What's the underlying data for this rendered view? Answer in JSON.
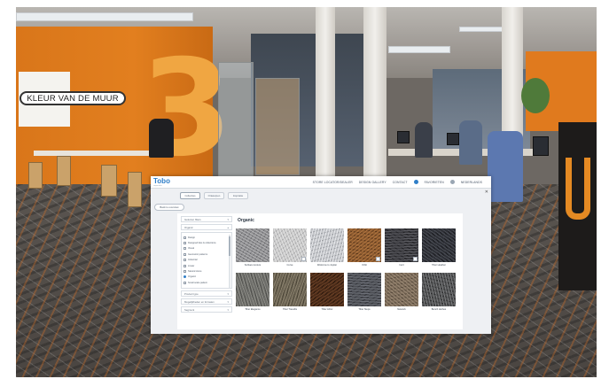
{
  "wall_sign": {
    "text": "KLEUR VAN DE MUUR"
  },
  "wall_number": "3",
  "ui": {
    "logo": "Tobo",
    "logo_sub": "carpet tiles",
    "topnav": [
      "STORE LOCATOR/DEALER",
      "DESIGN GALLERY",
      "CONTACT",
      "FAVORIETEN",
      "NEDERLANDS"
    ],
    "tabs": [
      "Collecties",
      "Ontwerpen",
      "Inspiratie"
    ],
    "back_button": "Back to overview",
    "content_title": "Organic",
    "sidebar": {
      "group_top": "Gekozen filters",
      "group_style": "Organic",
      "list_items": [
        {
          "label": "Design",
          "checked": false
        },
        {
          "label": "Designed tiles & collections",
          "checked": false
        },
        {
          "label": "Visual",
          "checked": false
        },
        {
          "label": "Geometric patterns",
          "checked": false
        },
        {
          "label": "Industrial",
          "checked": false
        },
        {
          "label": "Linear",
          "checked": false
        },
        {
          "label": "Natural stone",
          "checked": false
        },
        {
          "label": "Organic",
          "checked": true
        },
        {
          "label": "Small scale pattern",
          "checked": false
        }
      ],
      "groups_bottom": [
        "Product type",
        "Mogelijkheden en formaten",
        "Segment"
      ]
    },
    "tiles": [
      {
        "name": "Sorbaou texture",
        "colors": [
          "#8e8e90",
          "#b2b2b4",
          "#6e6e72"
        ],
        "badge": false
      },
      {
        "name": "Curve",
        "colors": [
          "#c8c8c8",
          "#e2e2e2",
          "#a9a9ab"
        ],
        "badge": true
      },
      {
        "name": "Welcome to Jupiter",
        "colors": [
          "#c2c4c8",
          "#e6e7ea",
          "#9ea1a6"
        ],
        "badge": false
      },
      {
        "name": "Orbit",
        "colors": [
          "#8b5a2f",
          "#b0743f",
          "#5f3a1c"
        ],
        "badge": true
      },
      {
        "name": "Inert",
        "colors": [
          "#3b3b3f",
          "#5b5b61",
          "#222226"
        ],
        "badge": true
      },
      {
        "name": "Tiber Heather",
        "colors": [
          "#2e3036",
          "#4a4d55",
          "#1c1d21"
        ],
        "badge": false
      },
      {
        "name": "Tiber Elegance",
        "colors": [
          "#6c6c68",
          "#8c8c86",
          "#4f4f4c"
        ],
        "badge": false
      },
      {
        "name": "Tiber Travellis",
        "colors": [
          "#6a6252",
          "#8a816d",
          "#4c4638"
        ],
        "badge": false
      },
      {
        "name": "Tiber Arbor",
        "colors": [
          "#4a2b18",
          "#6a4026",
          "#2e1a0e"
        ],
        "badge": false
      },
      {
        "name": "Tiber Steps",
        "colors": [
          "#4d4f55",
          "#6d7078",
          "#34363b"
        ],
        "badge": false
      },
      {
        "name": "Network",
        "colors": [
          "#7a6a58",
          "#9a8874",
          "#5a4d3f"
        ],
        "badge": false
      },
      {
        "name": "Bench Herbes",
        "colors": [
          "#4e4f50",
          "#7a7b7d",
          "#303132"
        ],
        "badge": false
      }
    ]
  }
}
